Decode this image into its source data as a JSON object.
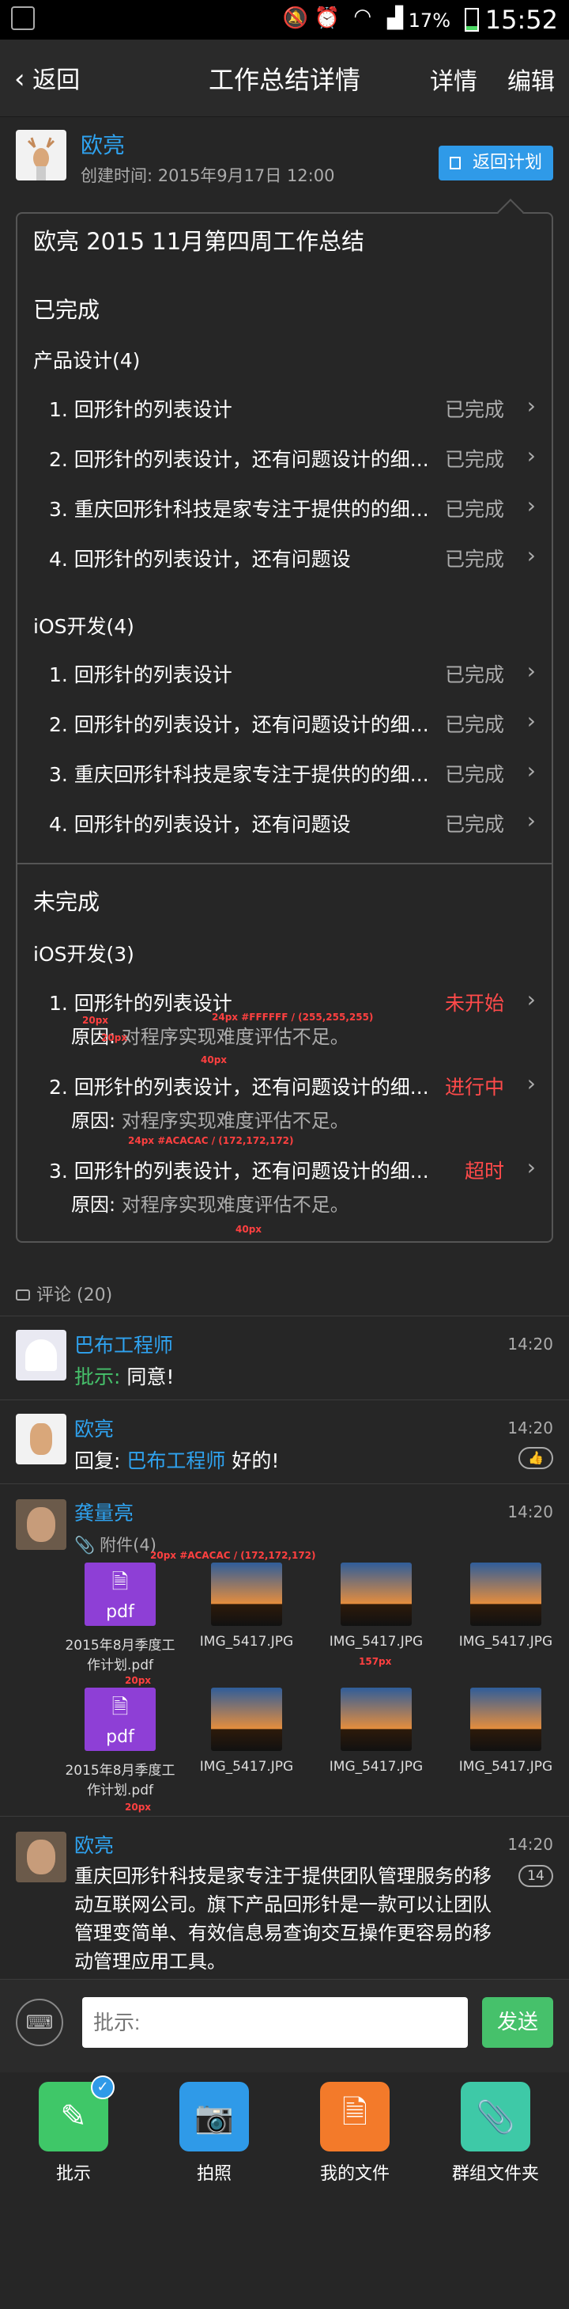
{
  "status_bar": {
    "battery": "17%",
    "time": "15:52"
  },
  "nav": {
    "back": "返回",
    "title": "工作总结详情",
    "detail": "详情",
    "edit": "编辑"
  },
  "header": {
    "author": "欧亮",
    "created": "创建时间: 2015年9月17日 12:00",
    "return_plan": "返回计划"
  },
  "summary": {
    "title": "欧亮 2015 11月第四周工作总结",
    "completed_label": "已完成",
    "groups": [
      {
        "name": "产品设计(4)",
        "items": [
          {
            "text": "1. 回形针的列表设计",
            "status": "已完成"
          },
          {
            "text": "2. 回形针的列表设计，还有问题设计的细...",
            "status": "已完成"
          },
          {
            "text": "3. 重庆回形针科技是家专注于提供的的细...",
            "status": "已完成"
          },
          {
            "text": "4. 回形针的列表设计，还有问题设",
            "status": "已完成"
          }
        ]
      },
      {
        "name": "iOS开发(4)",
        "items": [
          {
            "text": "1. 回形针的列表设计",
            "status": "已完成"
          },
          {
            "text": "2. 回形针的列表设计，还有问题设计的细...",
            "status": "已完成"
          },
          {
            "text": "3. 重庆回形针科技是家专注于提供的的细...",
            "status": "已完成"
          },
          {
            "text": "4. 回形针的列表设计，还有问题设",
            "status": "已完成"
          }
        ]
      }
    ],
    "incomplete_label": "未完成",
    "incomplete_group": "iOS开发(3)",
    "reason_label": "原因:",
    "incomplete_items": [
      {
        "text": "1. 回形针的列表设计",
        "status": "未开始",
        "reason": "对程序实现难度评估不足。"
      },
      {
        "text": "2. 回形针的列表设计，还有问题设计的细...",
        "status": "进行中",
        "reason": "对程序实现难度评估不足。"
      },
      {
        "text": "3. 回形针的列表设计，还有问题设计的细...",
        "status": "超时",
        "reason": "对程序实现难度评估不足。"
      }
    ]
  },
  "annotations": {
    "a1": "20px",
    "a2": "20px",
    "a3": "24px #FFFFFF / (255,255,255)",
    "a4": "40px",
    "a5": "24px #ACACAC / (172,172,172)",
    "a6": "40px",
    "a7": "20px #ACACAC / (172,172,172)",
    "a8": "20px",
    "a9": "157px",
    "a10": "20px"
  },
  "comments_header": "评论 (20)",
  "comments": [
    {
      "name": "巴布工程师",
      "time": "14:20",
      "prefix": "批示:",
      "text": "同意!"
    },
    {
      "name": "欧亮",
      "time": "14:20",
      "prefix": "回复:",
      "mention": "巴布工程师",
      "text": "好的!"
    },
    {
      "name": "龚量亮",
      "time": "14:20",
      "attachments_label": "附件(4)"
    },
    {
      "name": "欧亮",
      "time": "14:20",
      "text": "重庆回形针科技是家专注于提供团队管理服务的移动互联网公司。旗下产品回形针是一款可以让团队管理变简单、有效信息易查询交互操作更容易的移动管理应用工具。",
      "count": "14"
    }
  ],
  "attachments": [
    {
      "type": "pdf",
      "label": "pdf",
      "name": "2015年8月季度工作计划.pdf"
    },
    {
      "type": "img",
      "name": "IMG_5417.JPG"
    },
    {
      "type": "img",
      "name": "IMG_5417.JPG"
    },
    {
      "type": "img",
      "name": "IMG_5417.JPG"
    },
    {
      "type": "pdf",
      "label": "pdf",
      "name": "2015年8月季度工作计划.pdf"
    },
    {
      "type": "img",
      "name": "IMG_5417.JPG"
    },
    {
      "type": "img",
      "name": "IMG_5417.JPG"
    },
    {
      "type": "img",
      "name": "IMG_5417.JPG"
    }
  ],
  "input": {
    "placeholder": "批示:",
    "send": "发送"
  },
  "toolbar": [
    {
      "label": "批示",
      "color": "#3fc768"
    },
    {
      "label": "拍照",
      "color": "#2f9ae8"
    },
    {
      "label": "我的文件",
      "color": "#f37a2a"
    },
    {
      "label": "群组文件夹",
      "color": "#3ec9a7"
    }
  ]
}
